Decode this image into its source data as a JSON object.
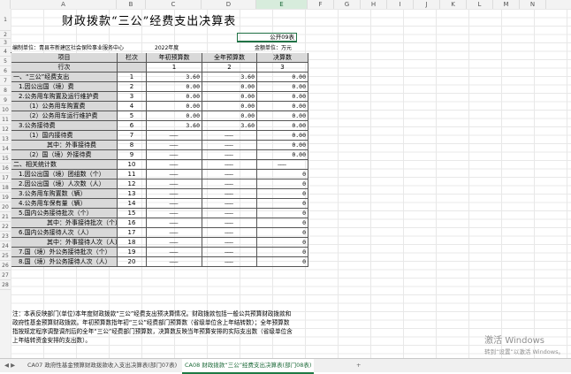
{
  "columns": [
    "A",
    "B",
    "C",
    "D",
    "E",
    "F",
    "G",
    "H",
    "I",
    "J",
    "K",
    "L",
    "M",
    "N"
  ],
  "rows": [
    "1",
    "2",
    "3",
    "4",
    "5",
    "6",
    "7",
    "8",
    "9",
    "10",
    "11",
    "12",
    "13",
    "14",
    "15",
    "16",
    "17",
    "18",
    "19",
    "20",
    "21",
    "22",
    "23",
    "24",
    "25",
    "26",
    "27",
    "28"
  ],
  "title": "财政拨款“三公”经费支出决算表",
  "form_code": "公开09表",
  "unit_label": "编制单位：青县市新建区社会保险事业服务中心",
  "year": "2022年度",
  "money_unit": "金额单位：万元",
  "header": {
    "item": "项目",
    "col": "栏次",
    "budget": "年初预算数",
    "full_year": "全年预算数",
    "final": "决算数"
  },
  "header2": {
    "item": "行次",
    "c1": "1",
    "c2": "2",
    "c3": "3"
  },
  "table_rows": [
    {
      "label": "一、“三公”经费支出",
      "n": "1",
      "a": "3.60",
      "b": "3.60",
      "c": "0.00",
      "indent": 0
    },
    {
      "label": "1.因公出国（境）费",
      "n": "2",
      "a": "0.00",
      "b": "0.00",
      "c": "0.00",
      "indent": 1
    },
    {
      "label": "2.公务用车购置及运行维护费",
      "n": "3",
      "a": "0.00",
      "b": "0.00",
      "c": "0.00",
      "indent": 1
    },
    {
      "label": "（1）公务用车购置费",
      "n": "4",
      "a": "0.00",
      "b": "0.00",
      "c": "0.00",
      "indent": 2
    },
    {
      "label": "（2）公务用车运行维护费",
      "n": "5",
      "a": "0.00",
      "b": "0.00",
      "c": "0.00",
      "indent": 2
    },
    {
      "label": "3.公务接待费",
      "n": "6",
      "a": "3.60",
      "b": "3.60",
      "c": "0.00",
      "indent": 1
    },
    {
      "label": "（1）国内接待费",
      "n": "7",
      "a": "———",
      "b": "———",
      "c": "0.00",
      "indent": 2
    },
    {
      "label": "其中：外事接待费",
      "n": "8",
      "a": "———",
      "b": "———",
      "c": "0.00",
      "indent": 3
    },
    {
      "label": "（2）国（境）外接待费",
      "n": "9",
      "a": "———",
      "b": "———",
      "c": "0.00",
      "indent": 2
    },
    {
      "label": "二、相关统计数",
      "n": "10",
      "a": "———",
      "b": "———",
      "c": "———",
      "indent": 0
    },
    {
      "label": "1.因公出国（境）团组数（个）",
      "n": "11",
      "a": "———",
      "b": "———",
      "c": "0",
      "indent": 1
    },
    {
      "label": "2.因公出国（境）人次数（人）",
      "n": "12",
      "a": "———",
      "b": "———",
      "c": "0",
      "indent": 1
    },
    {
      "label": "3.公务用车购置数（辆）",
      "n": "13",
      "a": "———",
      "b": "———",
      "c": "0",
      "indent": 1
    },
    {
      "label": "4.公务用车保有量（辆）",
      "n": "14",
      "a": "———",
      "b": "———",
      "c": "0",
      "indent": 1
    },
    {
      "label": "5.国内公务接待批次（个）",
      "n": "15",
      "a": "———",
      "b": "———",
      "c": "0",
      "indent": 1
    },
    {
      "label": "其中：外事接待批次（个）",
      "n": "16",
      "a": "———",
      "b": "———",
      "c": "0",
      "indent": 3
    },
    {
      "label": "6.国内公务接待人次（人）",
      "n": "17",
      "a": "———",
      "b": "———",
      "c": "0",
      "indent": 1
    },
    {
      "label": "其中：外事接待人次（人）",
      "n": "18",
      "a": "———",
      "b": "———",
      "c": "0",
      "indent": 3
    },
    {
      "label": "7.国（境）外公务接待批次（个）",
      "n": "19",
      "a": "———",
      "b": "———",
      "c": "0",
      "indent": 1
    },
    {
      "label": "8.国（境）外公务接待人次（人）",
      "n": "20",
      "a": "———",
      "b": "———",
      "c": "0",
      "indent": 1
    }
  ],
  "note": "注：本表反映部门(单位)本年度财政拨款“三公”经费支出预决算情况。财政拨款包括一般公共预算财政拨款和政府性基金预算财政拨款。年初预算数指年初“三公”经费部门预算数（省级单位含上年结转数）；全年预算数指按规定程序调整调剂后的全年“三公”经费部门预算数，决算数反映当年预算安排的实际支出数（省级单位含上年结转资金安排的支出数）。",
  "tabs": {
    "nav": "◀ ▶",
    "prev": "CA07 政府性基金预算财政拨款收入支出决算表(部门07表)",
    "active": "CA08 财政拨款“三公”经费支出决算表(部门08表)",
    "more": "+"
  },
  "watermark": {
    "line1": "激活 Windows",
    "line2": "转到“设置”以激活 Windows。"
  }
}
